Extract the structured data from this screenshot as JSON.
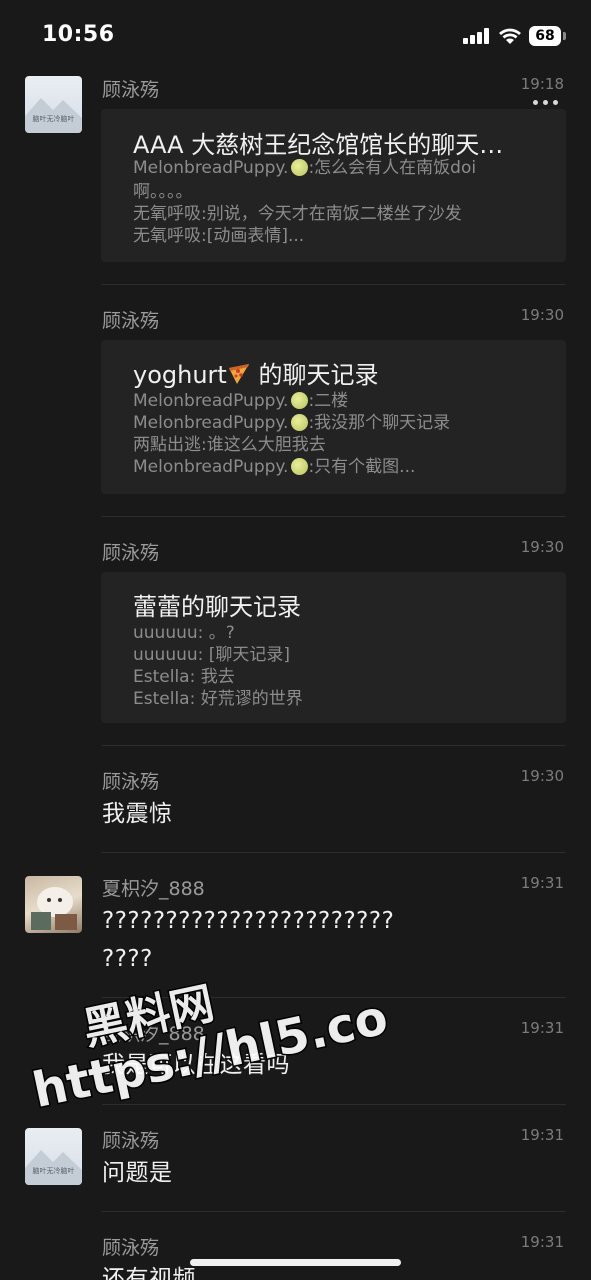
{
  "status_bar": {
    "time": "10:56",
    "battery": "68"
  },
  "messages": [
    {
      "sender": "顾泳殇",
      "time": "19:18",
      "avatar_text": "脑叶无冷脑叶",
      "card": {
        "title": "AAA 大慈树王纪念馆馆长的聊天…",
        "lines": [
          {
            "name": "MelonbreadPuppy.",
            "text": ":怎么会有人在南饭doi"
          },
          {
            "text": "啊。。。。"
          },
          {
            "text": "无氧呼吸:别说，今天才在南饭二楼坐了沙发"
          },
          {
            "text": "无氧呼吸:[动画表情]..."
          }
        ]
      }
    },
    {
      "sender": "顾泳殇",
      "time": "19:30",
      "card": {
        "title": "yoghurt",
        "title_suffix": "的聊天记录",
        "lines": [
          {
            "name": "MelonbreadPuppy.",
            "text": ":二楼"
          },
          {
            "name": "MelonbreadPuppy.",
            "text": ":我没那个聊天记录"
          },
          {
            "text": "两點出逃:谁这么大胆我去"
          },
          {
            "name": "MelonbreadPuppy.",
            "text": ":只有个截图..."
          }
        ]
      }
    },
    {
      "sender": "顾泳殇",
      "time": "19:30",
      "card": {
        "title": "蕾蕾的聊天记录",
        "lines": [
          {
            "text": "uuuuuu: 。?"
          },
          {
            "text": "uuuuuu: [聊天记录]"
          },
          {
            "text": "Estella: 我去"
          },
          {
            "text": "Estella: 好荒谬的世界"
          }
        ]
      }
    },
    {
      "sender": "顾泳殇",
      "time": "19:30",
      "text": "我震惊"
    },
    {
      "sender": "夏枳汐_888",
      "time": "19:31",
      "text_lines": [
        "???????????????????????",
        "????"
      ]
    },
    {
      "sender": "夏枳汐_888",
      "time": "19:31",
      "text": "我是可以在这看吗"
    },
    {
      "sender": "顾泳殇",
      "time": "19:31",
      "text": "问题是",
      "avatar_text": "脑叶无冷脑叶"
    },
    {
      "sender": "顾泳殇",
      "time": "19:31",
      "text": "还有视频"
    }
  ],
  "watermark": {
    "line1": "黑料网",
    "line2": "https://hl5.co"
  }
}
